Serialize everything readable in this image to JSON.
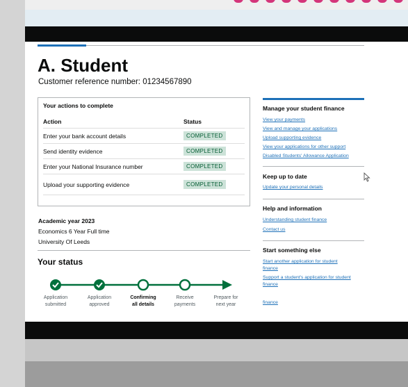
{
  "page": {
    "title": "A. Student",
    "customer_reference": "Customer reference number: 01234567890"
  },
  "actions_panel": {
    "heading": "Your actions to complete",
    "col_action": "Action",
    "col_status": "Status",
    "rows": [
      {
        "action": "Enter your bank account details",
        "status": "COMPLETED"
      },
      {
        "action": "Send identity evidence",
        "status": "COMPLETED"
      },
      {
        "action": "Enter your National Insurance number",
        "status": "COMPLETED"
      },
      {
        "action": "Upload your supporting evidence",
        "status": "COMPLETED"
      }
    ],
    "tag_color": "#cce2d8"
  },
  "academic": {
    "year": "Academic year 2023",
    "course": "Economics 6 Year Full time",
    "university": "University Of Leeds"
  },
  "status": {
    "heading": "Your status",
    "steps": [
      {
        "line1": "Application",
        "line2": "submitted",
        "state": "done"
      },
      {
        "line1": "Application",
        "line2": "approved",
        "state": "done"
      },
      {
        "line1": "Confirming",
        "line2": "all details",
        "state": "current"
      },
      {
        "line1": "Receive",
        "line2": "payments",
        "state": "todo"
      },
      {
        "line1": "Prepare for",
        "line2": "next year",
        "state": "todo"
      }
    ],
    "accent_color": "#00703c"
  },
  "sidebar": {
    "manage": {
      "heading": "Manage your student finance",
      "links": [
        "View your payments",
        "View and manage your applications",
        "Upload supporting evidence",
        "View your applications for other support",
        "Disabled Students' Allowance Application"
      ]
    },
    "keep_up": {
      "heading": "Keep up to date",
      "links": [
        "Update your personal details"
      ]
    },
    "help": {
      "heading": "Help and information",
      "links": [
        "Understanding student finance",
        "Contact us"
      ]
    },
    "start": {
      "heading": "Start something else",
      "links": [
        "Start another application for student finance",
        "Support a student's application for student finance"
      ],
      "extra_link": "finance"
    }
  },
  "colors": {
    "link": "#1d70b8",
    "header": "#0b0c0c",
    "brand_accent": "#d4357a"
  }
}
